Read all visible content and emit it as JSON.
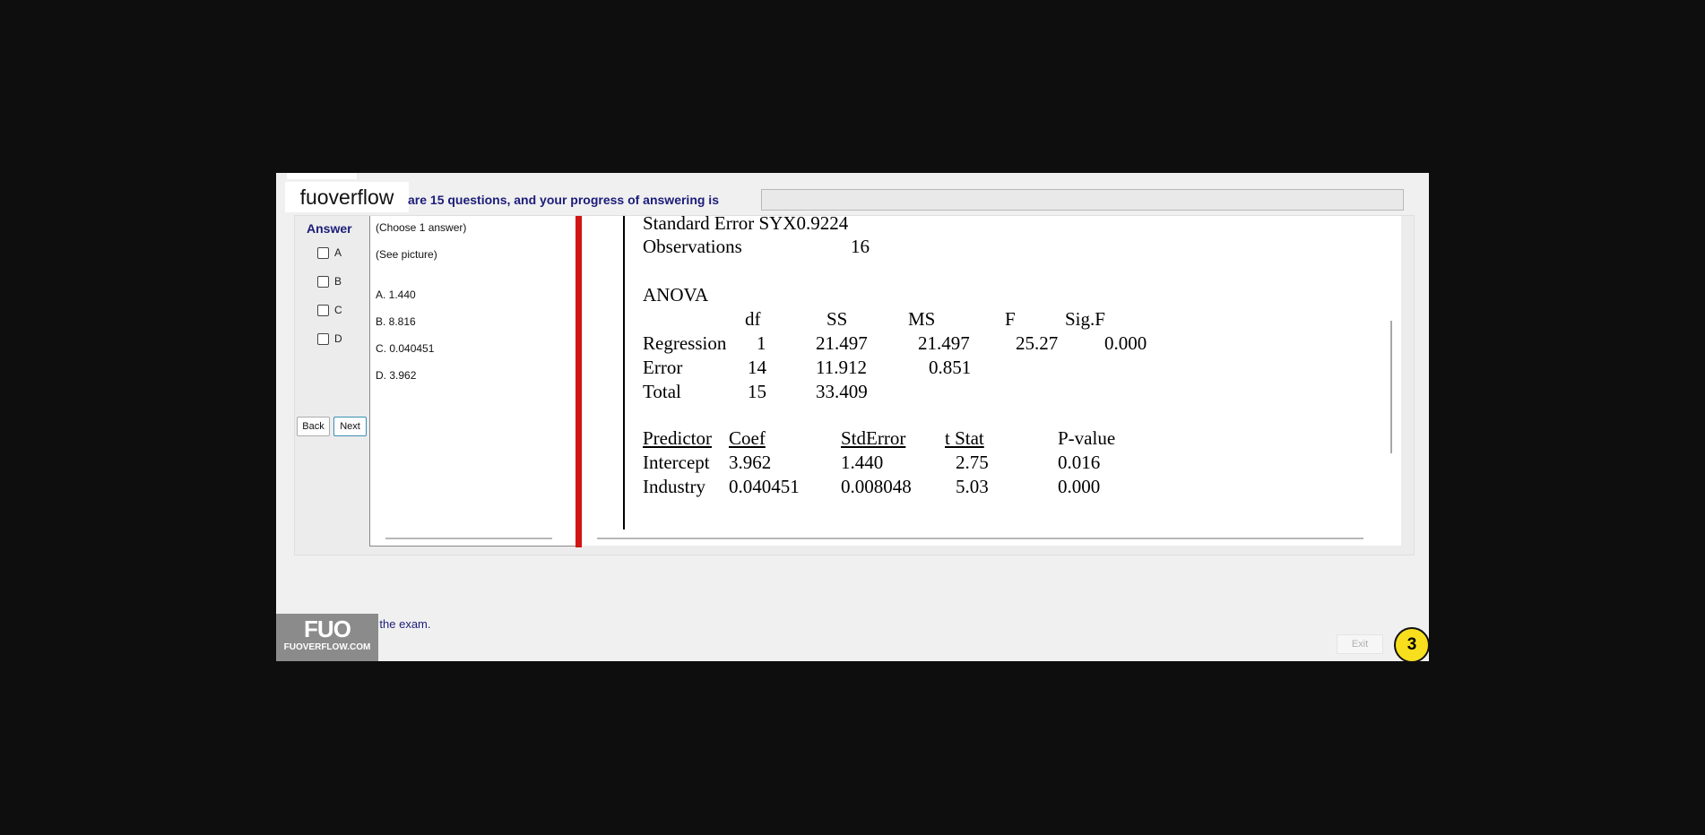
{
  "watermark": {
    "text": "fuoverflow"
  },
  "header": {
    "progress_text": "are 15 questions, and your progress of answering is"
  },
  "answer": {
    "title": "Answer",
    "options": [
      {
        "label": "A"
      },
      {
        "label": "B"
      },
      {
        "label": "C"
      },
      {
        "label": "D"
      }
    ]
  },
  "nav": {
    "back_label": "Back",
    "next_label": "Next"
  },
  "question": {
    "instruction": "(Choose 1 answer)",
    "prompt": "(See picture)",
    "choices": [
      "A. 1.440",
      "B. 8.816",
      "C. 0.040451",
      "D. 3.962"
    ]
  },
  "picture": {
    "std_error": "Standard Error SYX0.9224",
    "observations_label": "Observations",
    "observations_value": "16",
    "anova_title": "ANOVA",
    "anova_headers": [
      "df",
      "SS",
      "MS",
      "F",
      "Sig.F"
    ],
    "anova_rows": [
      {
        "name": "Regression",
        "df": "1",
        "ss": "21.497",
        "ms": "21.497",
        "f": "25.27",
        "sig": "0.000"
      },
      {
        "name": "Error",
        "df": "14",
        "ss": "11.912",
        "ms": "0.851",
        "f": "",
        "sig": ""
      },
      {
        "name": "Total",
        "df": "15",
        "ss": "33.409",
        "ms": "",
        "f": "",
        "sig": ""
      }
    ],
    "pred_headers": [
      "Predictor",
      "Coef",
      "StdError",
      "t Stat",
      "P-value"
    ],
    "pred_rows": [
      {
        "name": "Intercept",
        "coef": "3.962",
        "se": "1.440",
        "t": "2.75",
        "p": "0.016"
      },
      {
        "name": "Industry",
        "coef": "0.040451",
        "se": "0.008048",
        "t": "5.03",
        "p": "0.000"
      }
    ]
  },
  "footer": {
    "finish_text": "to finish the exam.",
    "logo_text": "FUO",
    "logo_subtext": "FUOVERFLOW.COM",
    "exit_label": "Exit"
  },
  "badge": {
    "number": "3"
  }
}
